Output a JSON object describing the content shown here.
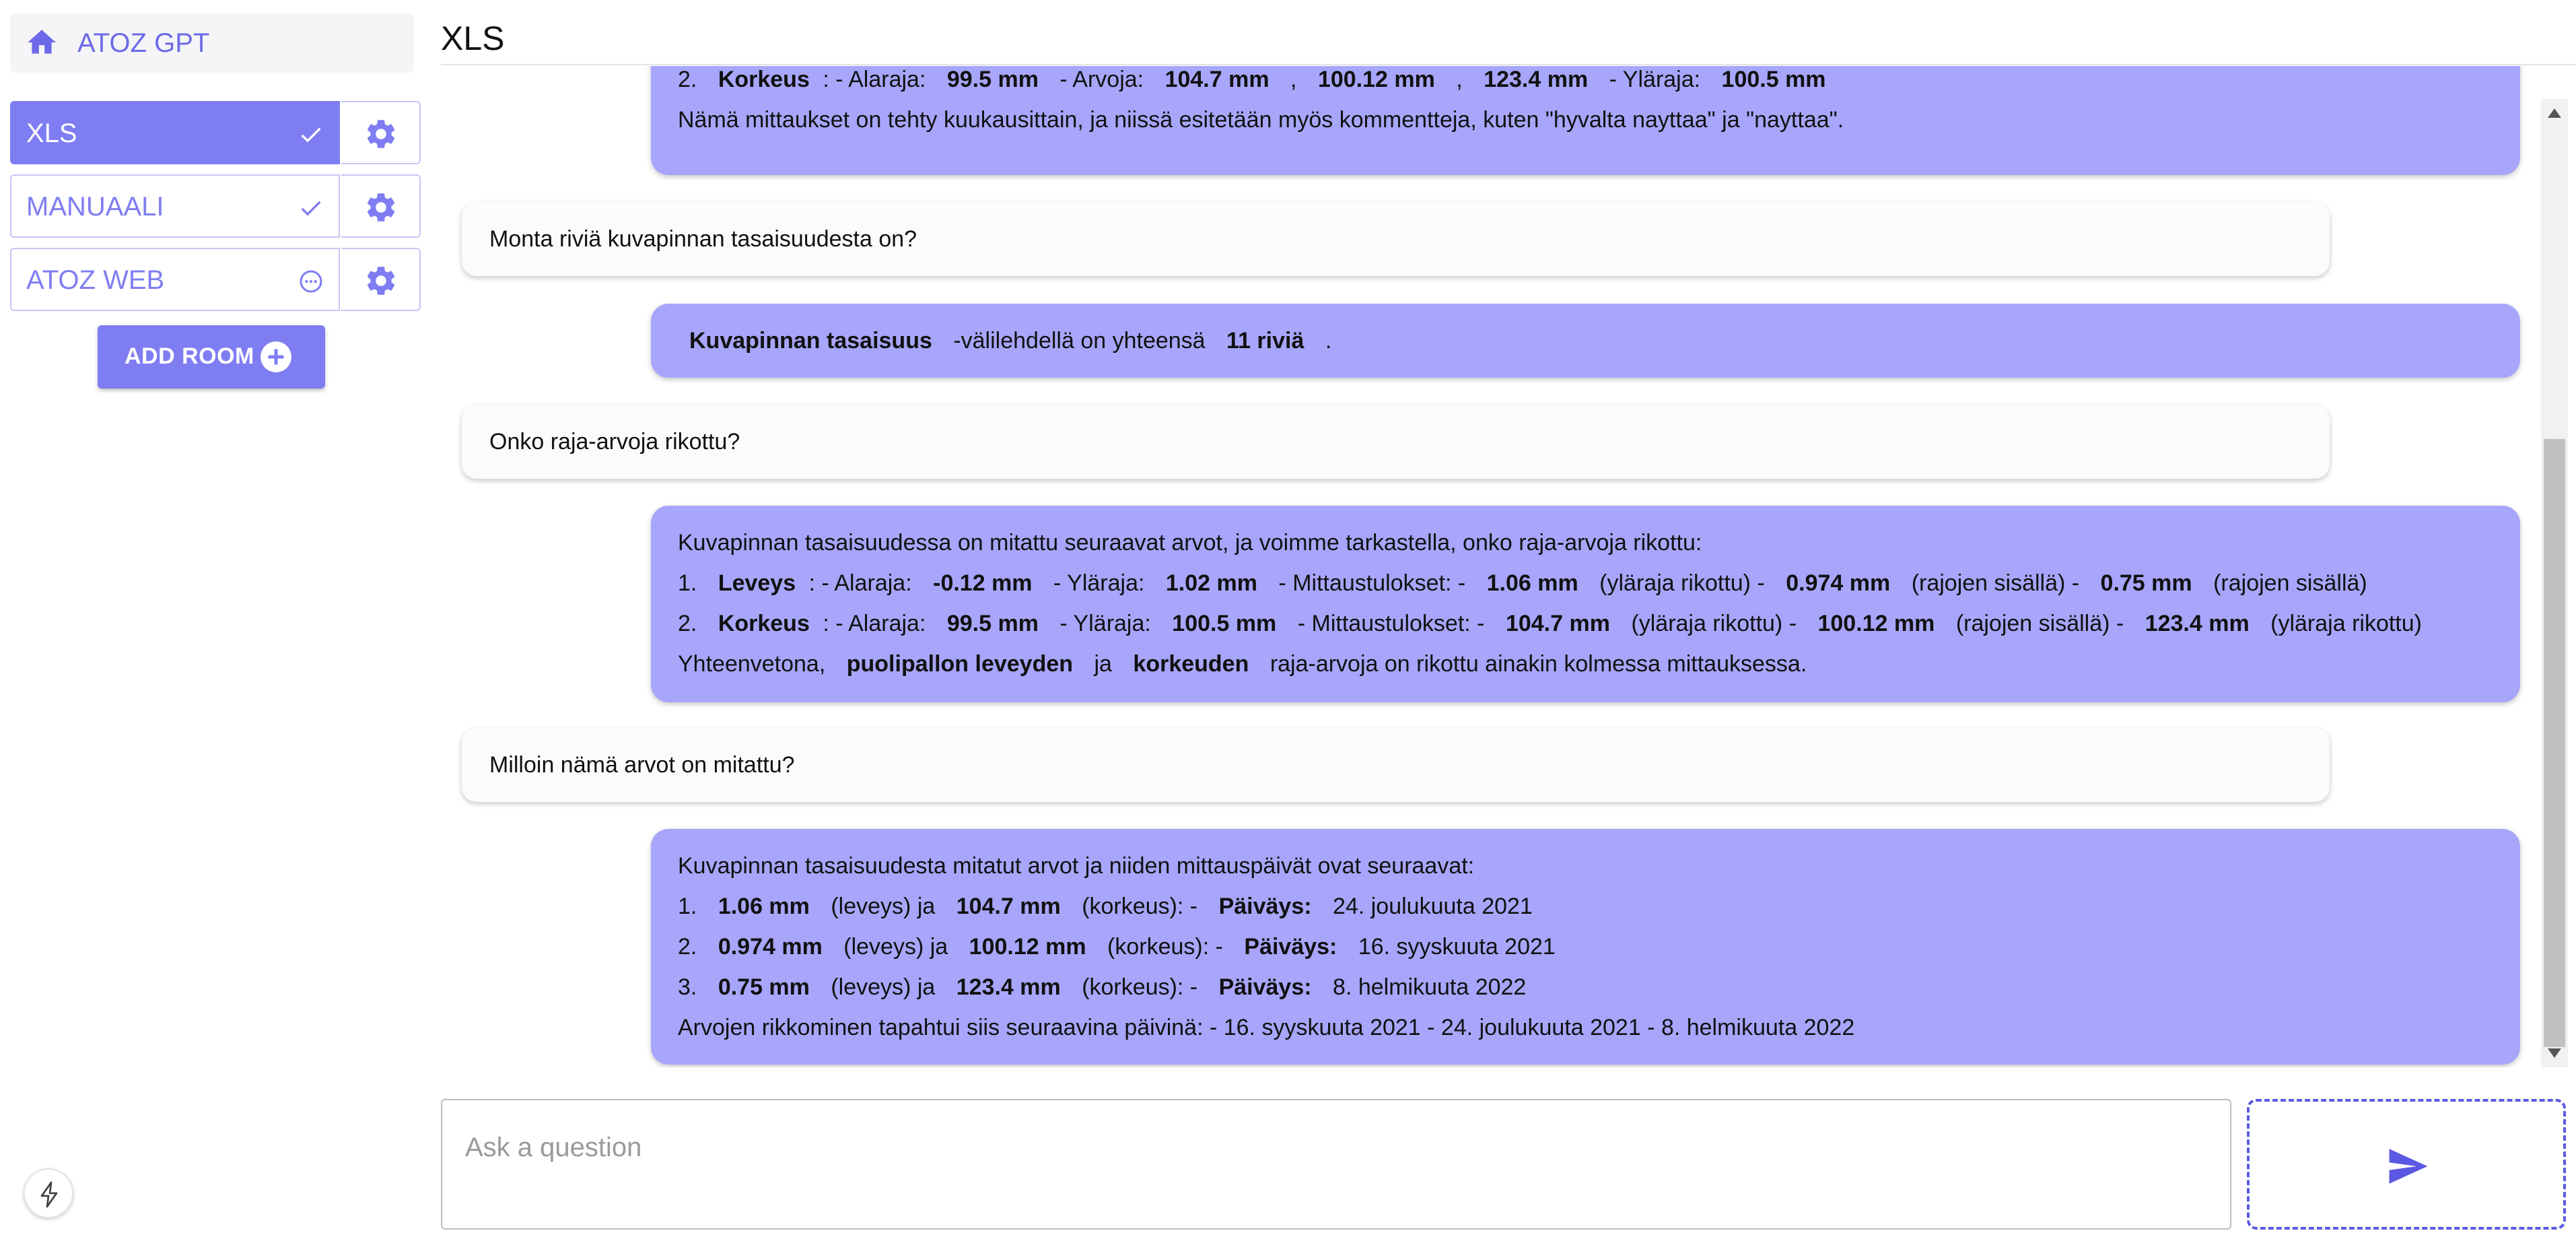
{
  "sidebar": {
    "home_label": "ATOZ GPT",
    "rooms": [
      {
        "name": "XLS",
        "status_icon": "check-icon",
        "active": true
      },
      {
        "name": "MANUAALI",
        "status_icon": "check-icon",
        "active": false
      },
      {
        "name": "ATOZ WEB",
        "status_icon": "pending-icon",
        "active": false
      }
    ],
    "add_room_label": "ADD ROOM"
  },
  "header": {
    "title": "XLS"
  },
  "colors": {
    "accent": "#7f7df2",
    "bot_bubble": "#a7a6fb",
    "user_bubble": "#fbfbfb"
  },
  "messages": [
    {
      "role": "bot",
      "lines": [
        [
          "2.",
          "Korkeus",
          ": - Alaraja:",
          "99.5 mm",
          "- Arvoja:",
          "104.7 mm",
          ",",
          "100.12 mm",
          ",",
          "123.4 mm",
          "- Yläraja:",
          "100.5 mm"
        ],
        [
          "Nämä mittaukset on tehty kuukausittain, ja niissä esitetään myös kommentteja, kuten \"hyvalta nayttaa\" ja \"nayttaa\"."
        ]
      ]
    },
    {
      "role": "user",
      "text": "Monta riviä kuvapinnan tasaisuudesta on?"
    },
    {
      "role": "bot",
      "lines": [
        [
          "Kuvapinnan tasaisuus",
          "-välilehdellä on yhteensä",
          "11 riviä",
          "."
        ]
      ]
    },
    {
      "role": "user",
      "text": "Onko raja-arvoja rikottu?"
    },
    {
      "role": "bot",
      "lines": [
        [
          "Kuvapinnan tasaisuudessa on mitattu seuraavat arvot, ja voimme tarkastella, onko raja-arvoja rikottu:"
        ],
        [
          "1.",
          "Leveys",
          ": - Alaraja:",
          "-0.12 mm",
          "- Yläraja:",
          "1.02 mm",
          "- Mittaustulokset: -",
          "1.06 mm",
          "(yläraja rikottu) -",
          "0.974 mm",
          "(rajojen sisällä) -",
          "0.75 mm",
          "(rajojen sisällä)"
        ],
        [
          "2.",
          "Korkeus",
          ": - Alaraja:",
          "99.5 mm",
          "- Yläraja:",
          "100.5 mm",
          "- Mittaustulokset: -",
          "104.7 mm",
          "(yläraja rikottu) -",
          "100.12 mm",
          "(rajojen sisällä) -",
          "123.4 mm",
          "(yläraja rikottu)"
        ],
        [
          "Yhteenvetona,",
          "puolipallon leveyden",
          "ja",
          "korkeuden",
          "raja-arvoja on rikottu ainakin kolmessa mittauksessa."
        ]
      ]
    },
    {
      "role": "user",
      "text": "Milloin nämä arvot on mitattu?"
    },
    {
      "role": "bot",
      "lines": [
        [
          "Kuvapinnan tasaisuudesta mitatut arvot ja niiden mittauspäivät ovat seuraavat:"
        ],
        [
          "1.",
          "1.06 mm",
          "(leveys) ja",
          "104.7 mm",
          "(korkeus): -",
          "Päiväys:",
          "24. joulukuuta 2021"
        ],
        [
          "2.",
          "0.974 mm",
          "(leveys) ja",
          "100.12 mm",
          "(korkeus): -",
          "Päiväys:",
          "16. syyskuuta 2021"
        ],
        [
          "3.",
          "0.75 mm",
          "(leveys) ja",
          "123.4 mm",
          "(korkeus): -",
          "Päiväys:",
          "8. helmikuuta 2022"
        ],
        [
          "Arvojen rikkominen tapahtui siis seuraavina päivinä: - 16. syyskuuta 2021 - 24. joulukuuta 2021 - 8. helmikuuta 2022"
        ]
      ]
    }
  ],
  "input": {
    "placeholder": "Ask a question",
    "value": ""
  },
  "send_icon": "send-icon"
}
